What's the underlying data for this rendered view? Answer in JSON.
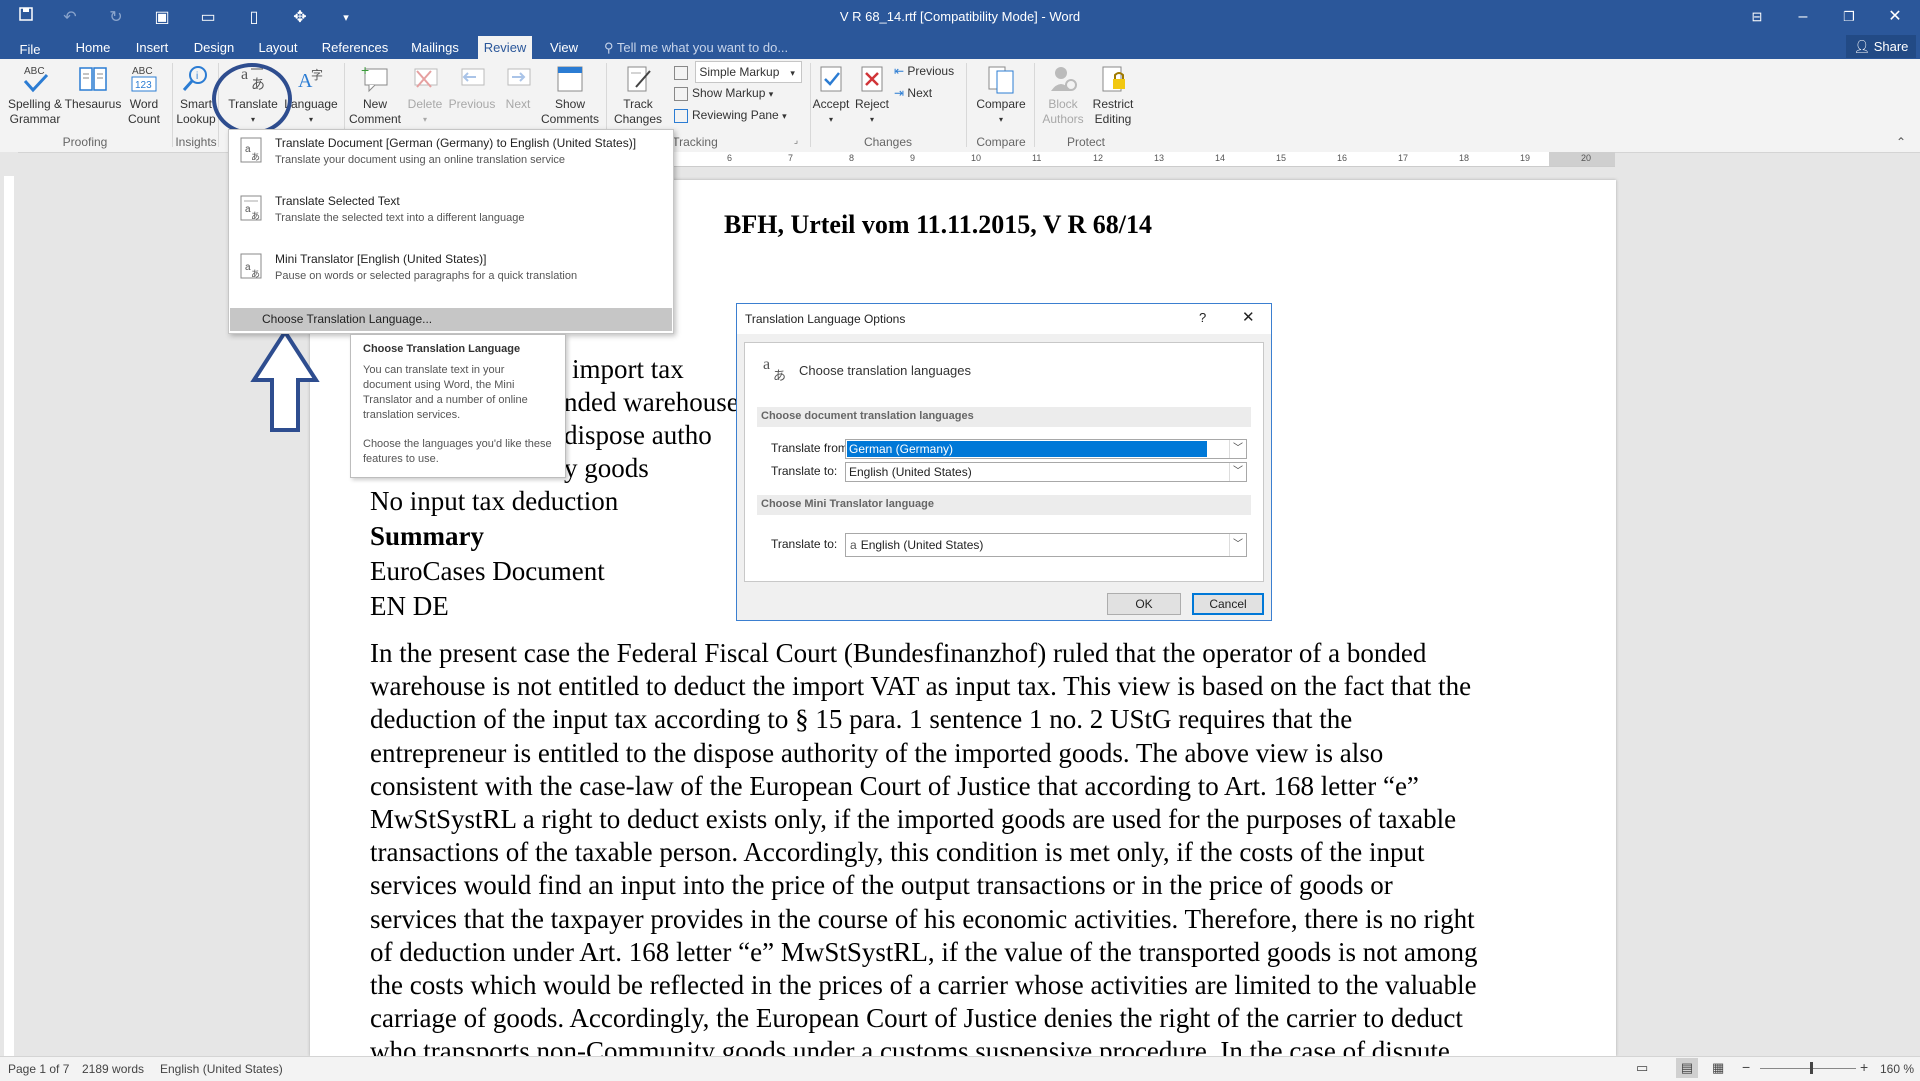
{
  "titlebar": {
    "title": "V R 68_14.rtf [Compatibility Mode]  -  Word",
    "tell_me": "Tell me what you want to do...",
    "share": "Share"
  },
  "tabs": [
    "File",
    "Home",
    "Insert",
    "Design",
    "Layout",
    "References",
    "Mailings",
    "Review",
    "View"
  ],
  "active_tab": "Review",
  "ribbon": {
    "spelling": "Spelling &\nGrammar",
    "thesaurus": "Thesaurus",
    "word_count": "Word\nCount",
    "smart_lookup": "Smart\nLookup",
    "translate": "Translate",
    "language": "Language",
    "new_comment": "New\nComment",
    "delete": "Delete",
    "previous": "Previous",
    "next": "Next",
    "show_comments": "Show\nComments",
    "track_changes": "Track\nChanges",
    "simple_markup": "Simple Markup",
    "show_markup": "Show Markup",
    "reviewing_pane": "Reviewing Pane",
    "accept": "Accept",
    "reject": "Reject",
    "prev_change": "Previous",
    "next_change": "Next",
    "compare": "Compare",
    "block_authors": "Block\nAuthors",
    "restrict_editing": "Restrict\nEditing",
    "groups": {
      "proofing": "Proofing",
      "insights": "Insights",
      "tracking": "Tracking",
      "changes": "Changes",
      "compare": "Compare",
      "protect": "Protect"
    }
  },
  "ruler_numbers": [
    "6",
    "7",
    "8",
    "9",
    "10",
    "11",
    "12",
    "13",
    "14",
    "15",
    "16",
    "17",
    "18",
    "19",
    "20"
  ],
  "translate_menu": {
    "item1_title": "Translate Document [German (Germany) to English (United States)]",
    "item1_desc": "Translate your document using an online translation service",
    "item2_title": "Translate Selected Text",
    "item2_desc": "Translate the selected text into a different language",
    "item3_title": "Mini Translator [English (United States)]",
    "item3_desc": "Pause on words or selected paragraphs for a quick translation",
    "item4_title": "Choose Translation Language..."
  },
  "tooltip": {
    "title": "Choose Translation Language",
    "p1": "You can translate text in your document using Word, the Mini Translator and a number of online translation services.",
    "p2": "Choose the languages you'd like these features to use."
  },
  "dialog": {
    "title": "Translation Language Options",
    "help": "?",
    "heading": "Choose translation languages",
    "section1": "Choose document translation languages",
    "from_label": "Translate from:",
    "from_value": "German (Germany)",
    "to_label": "Translate to:",
    "to_value": "English (United States)",
    "section2": "Choose Mini Translator language",
    "mini_label": "Translate to:",
    "mini_value": "English (United States)",
    "ok": "OK",
    "cancel": "Cancel"
  },
  "document": {
    "heading": "BFH, Urteil vom 11.11.2015, V R 68/14",
    "partial_lines": [
      "import tax",
      "nded warehouse",
      "dispose autho",
      "y goods"
    ],
    "line_no_input": "No input tax deduction",
    "summary": "Summary",
    "eurocases": "EuroCases Document",
    "lang": "EN DE",
    "paragraph": [
      "In the present case the Federal Fiscal Court (Bundesfinanzhof) ruled that the operator of a bonded",
      "warehouse is not entitled to deduct the import VAT as input tax. This view is based on the fact that the",
      "deduction of the input tax according to § 15 para. 1 sentence 1 no. 2 UStG requires that the",
      "entrepreneur is entitled to the dispose authority of the imported goods. The above view is also",
      "consistent with the case-law of the European Court of Justice that according to Art. 168 letter “e”",
      "MwStSystRL a right to deduct exists only, if the imported goods are used for the purposes of taxable",
      "transactions of the taxable person. Accordingly, this condition is met only, if the costs of the input",
      "services would find an input into the price of the output transactions or in the price of goods or",
      "services that the taxpayer provides in the course of his economic activities. Therefore, there is no right",
      "of deduction under Art. 168 letter “e” MwStSystRL, if the value of the transported goods is not among",
      "the costs which would be reflected in the prices of a carrier whose activities are limited to the valuable",
      "carriage of goods. Accordingly, the European Court of Justice denies the right of the carrier to deduct",
      "who transports non-Community goods under a customs suspensive procedure. In the case of dispute"
    ]
  },
  "statusbar": {
    "page": "Page 1 of 7",
    "words": "2189 words",
    "language": "English (United States)",
    "zoom": "160 %"
  },
  "colors": {
    "accent": "#2b579a",
    "annotation": "#2e4d8f",
    "selection": "#0078d7"
  }
}
